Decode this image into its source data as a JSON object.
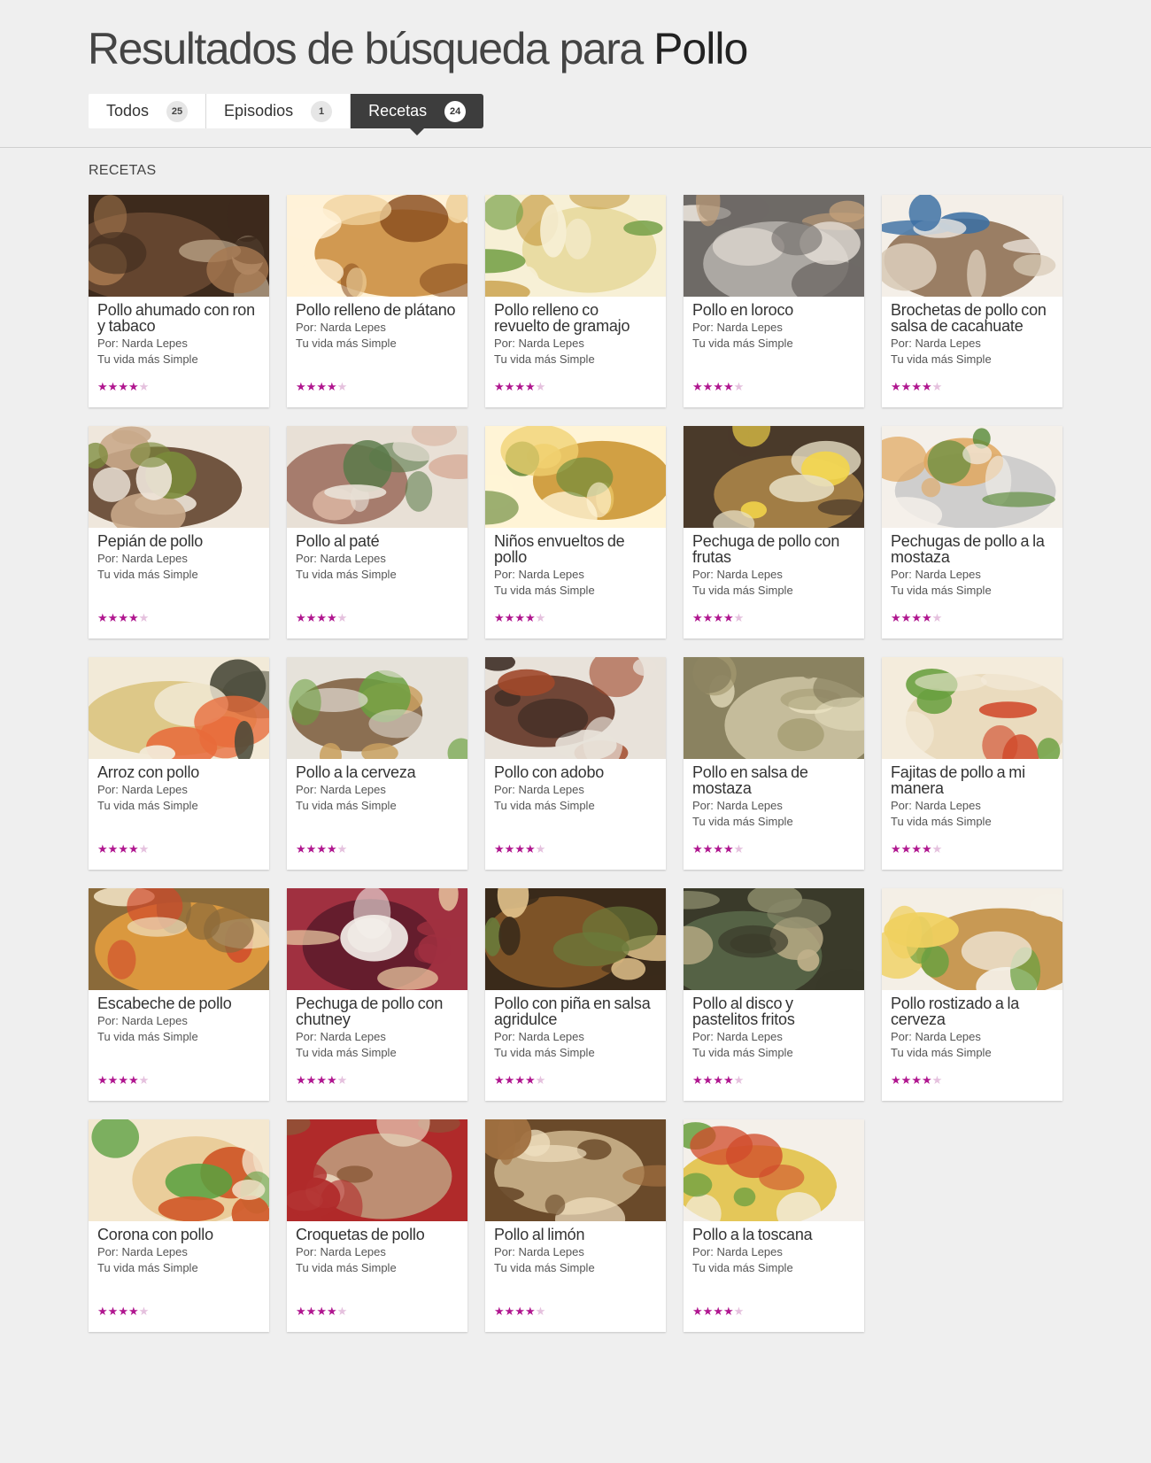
{
  "header": {
    "title_prefix": "Resultados de búsqueda para",
    "query": "Pollo"
  },
  "tabs": [
    {
      "label": "Todos",
      "count": "25",
      "active": false
    },
    {
      "label": "Episodios",
      "count": "1",
      "active": false
    },
    {
      "label": "Recetas",
      "count": "24",
      "active": true
    }
  ],
  "section_title": "RECETAS",
  "colors": {
    "accent_star": "#b0168f",
    "star_off": "#e5c1de",
    "active_tab": "#3d3d3d",
    "background": "#efefef"
  },
  "recipes": [
    {
      "title": "Pollo ahumado con ron y tabaco",
      "author": "Por: Narda Lepes",
      "show": "Tu vida más Simple",
      "rating": 4,
      "rating_max": 5,
      "image": "pollo-ahumado-photo"
    },
    {
      "title": "Pollo relleno de plátano",
      "author": "Por: Narda Lepes",
      "show": "Tu vida más Simple",
      "rating": 4,
      "rating_max": 5,
      "image": "pollo-relleno-platano-photo"
    },
    {
      "title": "Pollo relleno co  revuelto de gramajo",
      "author": "Por: Narda Lepes",
      "show": "Tu vida más Simple",
      "rating": 4,
      "rating_max": 5,
      "image": "pollo-relleno-gramajo-photo"
    },
    {
      "title": "Pollo en loroco",
      "author": "Por: Narda Lepes",
      "show": "Tu vida más Simple",
      "rating": 4,
      "rating_max": 5,
      "image": "pollo-loroco-photo"
    },
    {
      "title": "Brochetas de pollo con salsa de cacahuate",
      "author": "Por: Narda Lepes",
      "show": "Tu vida más Simple",
      "rating": 4,
      "rating_max": 5,
      "image": "brochetas-photo"
    },
    {
      "title": "Pepián de pollo",
      "author": "Por: Narda Lepes",
      "show": "Tu vida más Simple",
      "rating": 4,
      "rating_max": 5,
      "image": "pepian-photo"
    },
    {
      "title": "Pollo al paté",
      "author": "Por: Narda Lepes",
      "show": "Tu vida más Simple",
      "rating": 4,
      "rating_max": 5,
      "image": "pollo-pate-photo"
    },
    {
      "title": "Niños envueltos de pollo",
      "author": "Por: Narda Lepes",
      "show": "Tu vida más Simple",
      "rating": 4,
      "rating_max": 5,
      "image": "ninos-envueltos-photo"
    },
    {
      "title": "Pechuga de pollo con frutas",
      "author": "Por: Narda Lepes",
      "show": "Tu vida más Simple",
      "rating": 4,
      "rating_max": 5,
      "image": "pechuga-frutas-photo"
    },
    {
      "title": "Pechugas de pollo a la mostaza",
      "author": "Por: Narda Lepes",
      "show": "Tu vida más Simple",
      "rating": 4,
      "rating_max": 5,
      "image": "pechugas-mostaza-photo"
    },
    {
      "title": "Arroz con pollo",
      "author": "Por: Narda Lepes",
      "show": "Tu vida más Simple",
      "rating": 4,
      "rating_max": 5,
      "image": "arroz-pollo-photo"
    },
    {
      "title": "Pollo a la cerveza",
      "author": "Por: Narda Lepes",
      "show": "Tu vida más Simple",
      "rating": 4,
      "rating_max": 5,
      "image": "pollo-cerveza-photo"
    },
    {
      "title": "Pollo con adobo",
      "author": "Por: Narda Lepes",
      "show": "Tu vida más Simple",
      "rating": 4,
      "rating_max": 5,
      "image": "pollo-adobo-photo"
    },
    {
      "title": "Pollo en salsa de mostaza",
      "author": "Por: Narda Lepes",
      "show": "Tu vida más Simple",
      "rating": 4,
      "rating_max": 5,
      "image": "pollo-salsa-mostaza-photo"
    },
    {
      "title": "Fajitas de pollo a mi manera",
      "author": "Por: Narda Lepes",
      "show": "Tu vida más Simple",
      "rating": 4,
      "rating_max": 5,
      "image": "fajitas-photo"
    },
    {
      "title": "Escabeche de pollo",
      "author": "Por: Narda Lepes",
      "show": "Tu vida más Simple",
      "rating": 4,
      "rating_max": 5,
      "image": "escabeche-photo"
    },
    {
      "title": "Pechuga de pollo con chutney",
      "author": "Por: Narda Lepes",
      "show": "Tu vida más Simple",
      "rating": 4,
      "rating_max": 5,
      "image": "pechuga-chutney-photo"
    },
    {
      "title": "Pollo con piña en salsa agridulce",
      "author": "Por: Narda Lepes",
      "show": "Tu vida más Simple",
      "rating": 4,
      "rating_max": 5,
      "image": "pollo-pina-photo"
    },
    {
      "title": "Pollo al disco y pastelitos fritos",
      "author": "Por: Narda Lepes",
      "show": "Tu vida más Simple",
      "rating": 4,
      "rating_max": 5,
      "image": "pollo-disco-photo"
    },
    {
      "title": "Pollo rostizado a la cerveza",
      "author": "Por: Narda Lepes",
      "show": "Tu vida más Simple",
      "rating": 4,
      "rating_max": 5,
      "image": "pollo-rostizado-photo"
    },
    {
      "title": "Corona con pollo",
      "author": "Por: Narda Lepes",
      "show": "Tu vida más Simple",
      "rating": 4,
      "rating_max": 5,
      "image": "corona-pollo-photo"
    },
    {
      "title": "Croquetas de pollo",
      "author": "Por: Narda Lepes",
      "show": "Tu vida más Simple",
      "rating": 4,
      "rating_max": 5,
      "image": "croquetas-photo"
    },
    {
      "title": "Pollo al limón",
      "author": "Por: Narda Lepes",
      "show": "Tu vida más Simple",
      "rating": 4,
      "rating_max": 5,
      "image": "pollo-limon-photo"
    },
    {
      "title": "Pollo a la toscana",
      "author": "Por: Narda Lepes",
      "show": "Tu vida más Simple",
      "rating": 4,
      "rating_max": 5,
      "image": "pollo-toscana-photo"
    }
  ]
}
